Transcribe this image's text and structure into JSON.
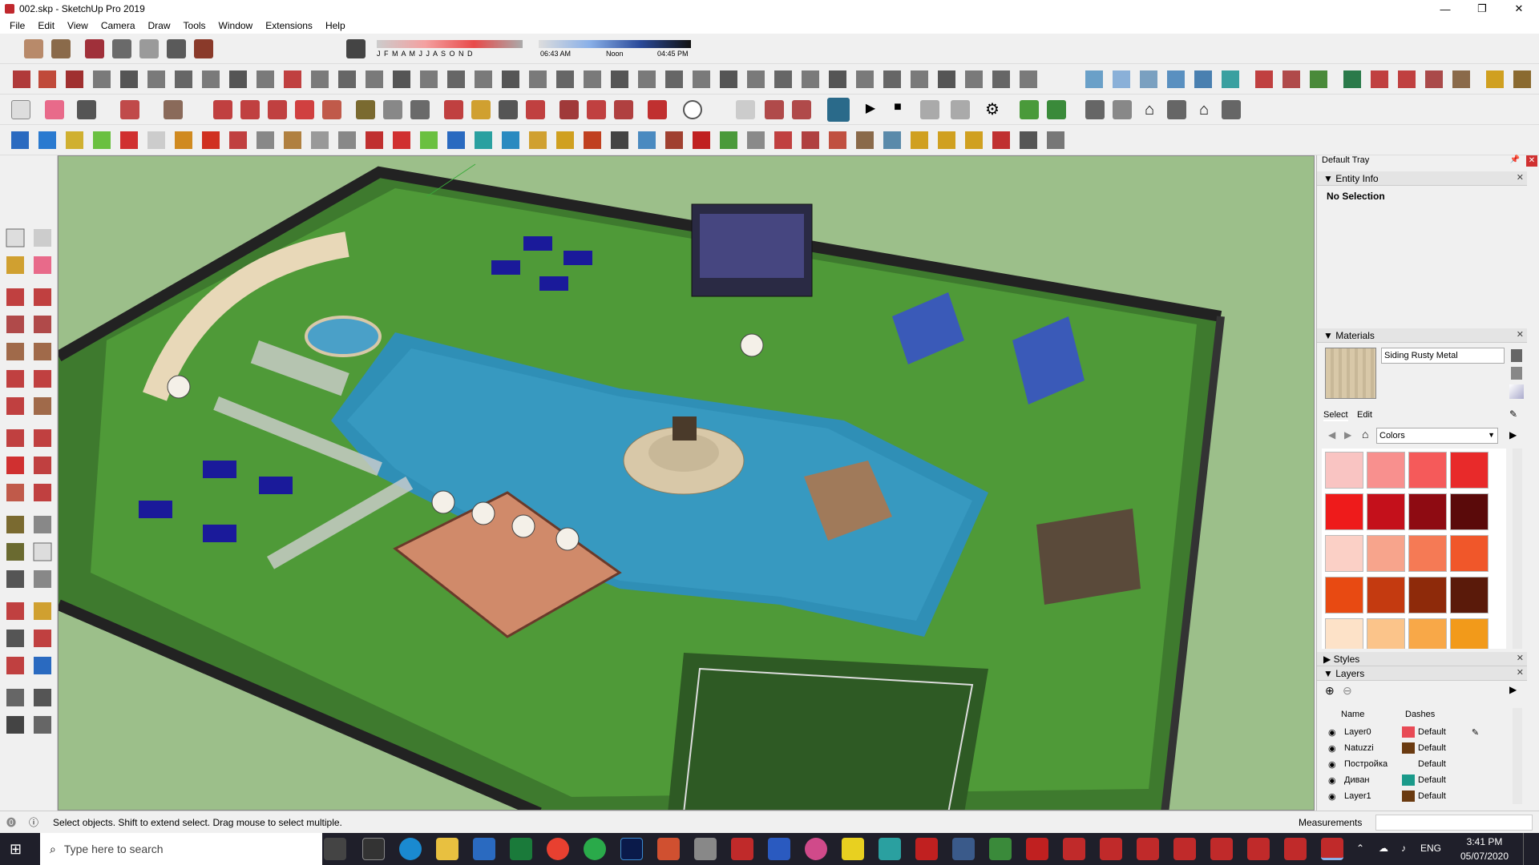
{
  "window": {
    "title": "002.skp - SketchUp Pro 2019",
    "minimize": "—",
    "maximize": "❐",
    "close": "✕"
  },
  "menu": [
    "File",
    "Edit",
    "View",
    "Camera",
    "Draw",
    "Tools",
    "Window",
    "Extensions",
    "Help"
  ],
  "shadow": {
    "months": "J F M A M J J A S O N D",
    "time_start": "06:43 AM",
    "time_mid": "Noon",
    "time_end": "04:45 PM"
  },
  "tray": {
    "title": "Default Tray",
    "entity_info": {
      "header": "Entity Info",
      "value": "No Selection"
    },
    "materials": {
      "header": "Materials",
      "name": "Siding Rusty Metal",
      "tab_select": "Select",
      "tab_edit": "Edit",
      "collection": "Colors",
      "swatches": [
        "#f9c4c2",
        "#f8908e",
        "#f55a5a",
        "#e82a2a",
        "#ee1b1b",
        "#c4101b",
        "#8e0b12",
        "#5a0a0a",
        "#fbd0c6",
        "#f7a48c",
        "#f57a55",
        "#f0572a",
        "#e84a12",
        "#c43a10",
        "#8e2a0a",
        "#5a1a0a",
        "#fde2c8",
        "#fbc48a",
        "#f8a848",
        "#f29a1a"
      ]
    },
    "styles": {
      "header": "Styles"
    },
    "layers": {
      "header": "Layers",
      "col_name": "Name",
      "col_dashes": "Dashes",
      "rows": [
        {
          "name": "Layer0",
          "color": "#e84a55",
          "dashes": "Default"
        },
        {
          "name": "Natuzzi",
          "color": "#6a3a10",
          "dashes": "Default"
        },
        {
          "name": "Постройка",
          "color": "#f0f0f0",
          "dashes": "Default"
        },
        {
          "name": "Диван",
          "color": "#1a9a8a",
          "dashes": "Default"
        },
        {
          "name": "Layer1",
          "color": "#6a3a10",
          "dashes": "Default"
        }
      ]
    }
  },
  "status": {
    "text": "Select objects. Shift to extend select. Drag mouse to select multiple.",
    "measurements": "Measurements"
  },
  "taskbar": {
    "search_placeholder": "Type here to search",
    "lang": "ENG",
    "time": "3:41 PM",
    "date": "05/07/2020"
  }
}
